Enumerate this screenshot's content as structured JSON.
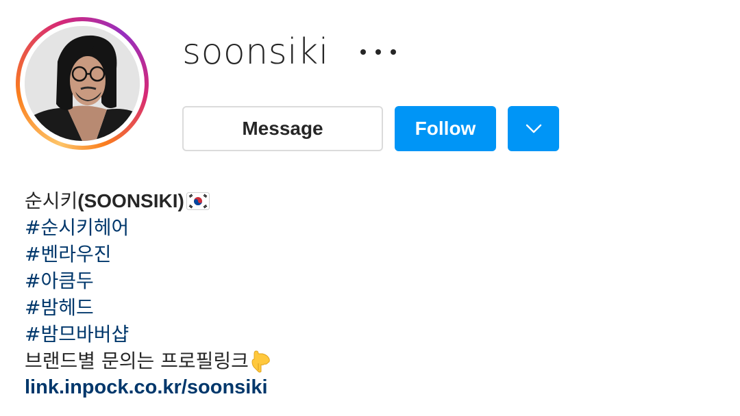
{
  "profile": {
    "username": "soonsiki",
    "avatar_alt": "profile photo"
  },
  "actions": {
    "message_label": "Message",
    "follow_label": "Follow"
  },
  "bio": {
    "name_prefix": "순시키",
    "name_strong": "(SOONSIKI)",
    "hashtags": [
      "#순시키헤어",
      "#벤라우진",
      "#아큼두",
      "#밤헤드",
      "#밤므바버샵"
    ],
    "note": "브랜드별 문의는 프로필링크",
    "link": "link.inpock.co.kr/soonsiki"
  },
  "colors": {
    "primary_blue": "#0095f6",
    "link_blue": "#00376b",
    "text": "#262626",
    "border": "#dbdbdb"
  },
  "icons": {
    "more": "more-horizontal-icon",
    "dropdown": "chevron-down-icon",
    "flag": "south-korea-flag-icon",
    "pointing": "pointing-down-hand-icon"
  }
}
